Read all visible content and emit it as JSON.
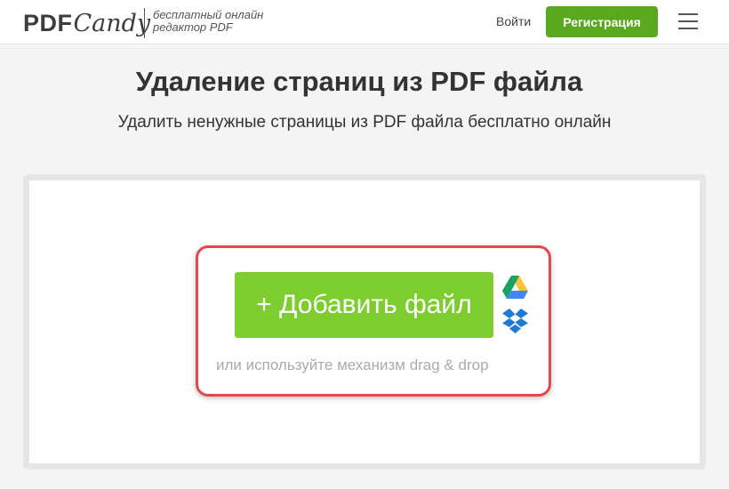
{
  "header": {
    "logo_pdf": "PDF",
    "logo_candy": "Candy",
    "tagline_line1": "бесплатный онлайн",
    "tagline_line2": "редактор PDF",
    "login_label": "Войти",
    "register_label": "Регистрация",
    "menu_icon": "hamburger-menu-icon"
  },
  "main": {
    "title": "Удаление страниц из PDF файла",
    "subtitle": "Удалить ненужные страницы из PDF файла бесплатно онлайн"
  },
  "upload": {
    "add_file_label": "+ Добавить файл",
    "dragdrop_hint": "или используйте механизм drag & drop",
    "google_drive_icon": "google-drive-icon",
    "dropbox_icon": "dropbox-icon"
  },
  "colors": {
    "brand_green": "#5aa81e",
    "add_button_green": "#7dcd2e",
    "highlight_red": "#e5484d",
    "text_dark": "#333333"
  }
}
